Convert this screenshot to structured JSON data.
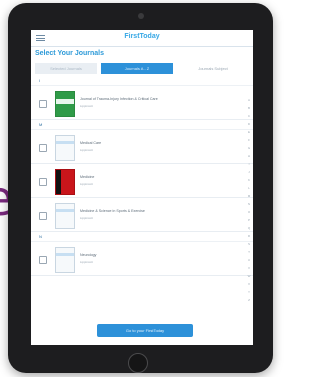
{
  "background_word": "e",
  "colors": {
    "accent": "#2d91d9",
    "title_blue": "#35a7e5",
    "tablet_frame": "#1d1d1f",
    "background_word": "#7b2a7f"
  },
  "app": {
    "title": "FirstToday",
    "menu_icon": "hamburger-icon"
  },
  "section_title": "Select Your Journals",
  "tabs": [
    {
      "label": "Selected Journals",
      "active": false
    },
    {
      "label": "Journals A - Z",
      "active": true
    },
    {
      "label": "Journals Subject",
      "active": false
    }
  ],
  "list": {
    "letters": [
      "I",
      "M",
      "N"
    ],
    "items": [
      {
        "name": "Journal of Trauma-Injury Infection & Critical Care",
        "sub": "Lippincott",
        "checked": false,
        "cover_color": "#2f9b48"
      },
      {
        "name": "Medical Care",
        "sub": "Lippincott",
        "checked": false,
        "cover_color": "#f6f9fb"
      },
      {
        "name": "Medicine",
        "sub": "Lippincott",
        "checked": false,
        "cover_color": "#c9151b"
      },
      {
        "name": "Medicine & Science in Sports & Exercise",
        "sub": "Lippincott",
        "checked": false,
        "cover_color": "#f6f9fb"
      },
      {
        "name": "Neurology",
        "sub": "Lippincott",
        "checked": false,
        "cover_color": "#f6f9fb"
      }
    ]
  },
  "alpha_index": [
    "A",
    "B",
    "C",
    "D",
    "E",
    "F",
    "G",
    "H",
    "I",
    "J",
    "K",
    "L",
    "M",
    "N",
    "O",
    "P",
    "Q",
    "R",
    "S",
    "T",
    "U",
    "V",
    "W",
    "X",
    "Y",
    "Z"
  ],
  "go_button": {
    "label": "Go to your FirstToday"
  }
}
